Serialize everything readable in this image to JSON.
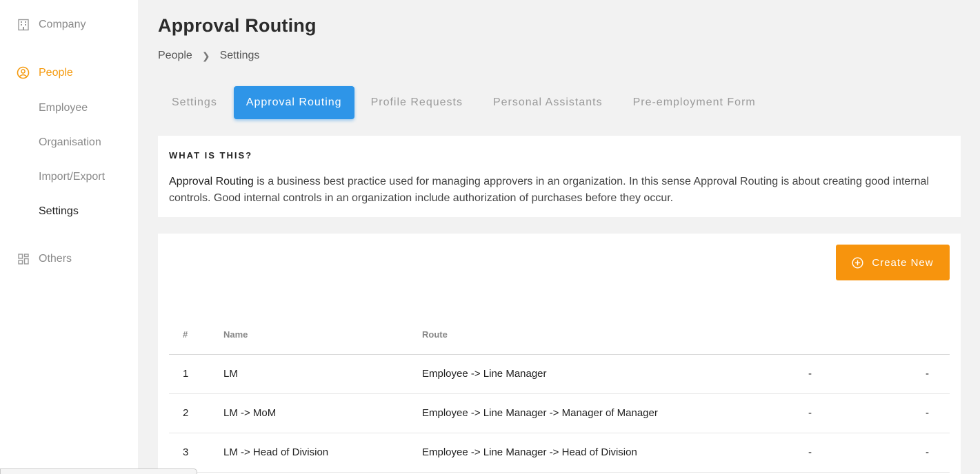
{
  "sidebar": {
    "company": {
      "label": "Company",
      "icon": "building-icon"
    },
    "people": {
      "label": "People",
      "icon": "user-circle-icon"
    },
    "sub_items": [
      "Employee",
      "Organisation",
      "Import/Export",
      "Settings"
    ],
    "others": {
      "label": "Others",
      "icon": "grid-icon"
    }
  },
  "page": {
    "title": "Approval Routing",
    "breadcrumb": [
      "People",
      "Settings"
    ]
  },
  "tabs": [
    "Settings",
    "Approval Routing",
    "Profile Requests",
    "Personal Assistants",
    "Pre-employment Form"
  ],
  "info": {
    "heading": "WHAT IS THIS?",
    "bold_term": "Approval Routing",
    "text": " is a business best practice used for managing approvers in an organization. In this sense Approval Routing is about creating good internal controls. Good internal controls in an organization include authorization of purchases before they occur."
  },
  "actions": {
    "create_label": "Create New"
  },
  "table": {
    "headers": [
      "#",
      "Name",
      "Route",
      "",
      ""
    ],
    "rows": [
      {
        "num": "1",
        "name": "LM",
        "route": "Employee -> Line Manager",
        "a": "-",
        "b": "-"
      },
      {
        "num": "2",
        "name": "LM -> MoM",
        "route": "Employee -> Line Manager -> Manager of Manager",
        "a": "-",
        "b": "-"
      },
      {
        "num": "3",
        "name": "LM -> Head of Division",
        "route": "Employee -> Line Manager -> Head of Division",
        "a": "-",
        "b": "-"
      }
    ]
  },
  "colors": {
    "accent": "#f59a0e",
    "tab_active": "#2e95e8",
    "button": "#f7940d"
  }
}
